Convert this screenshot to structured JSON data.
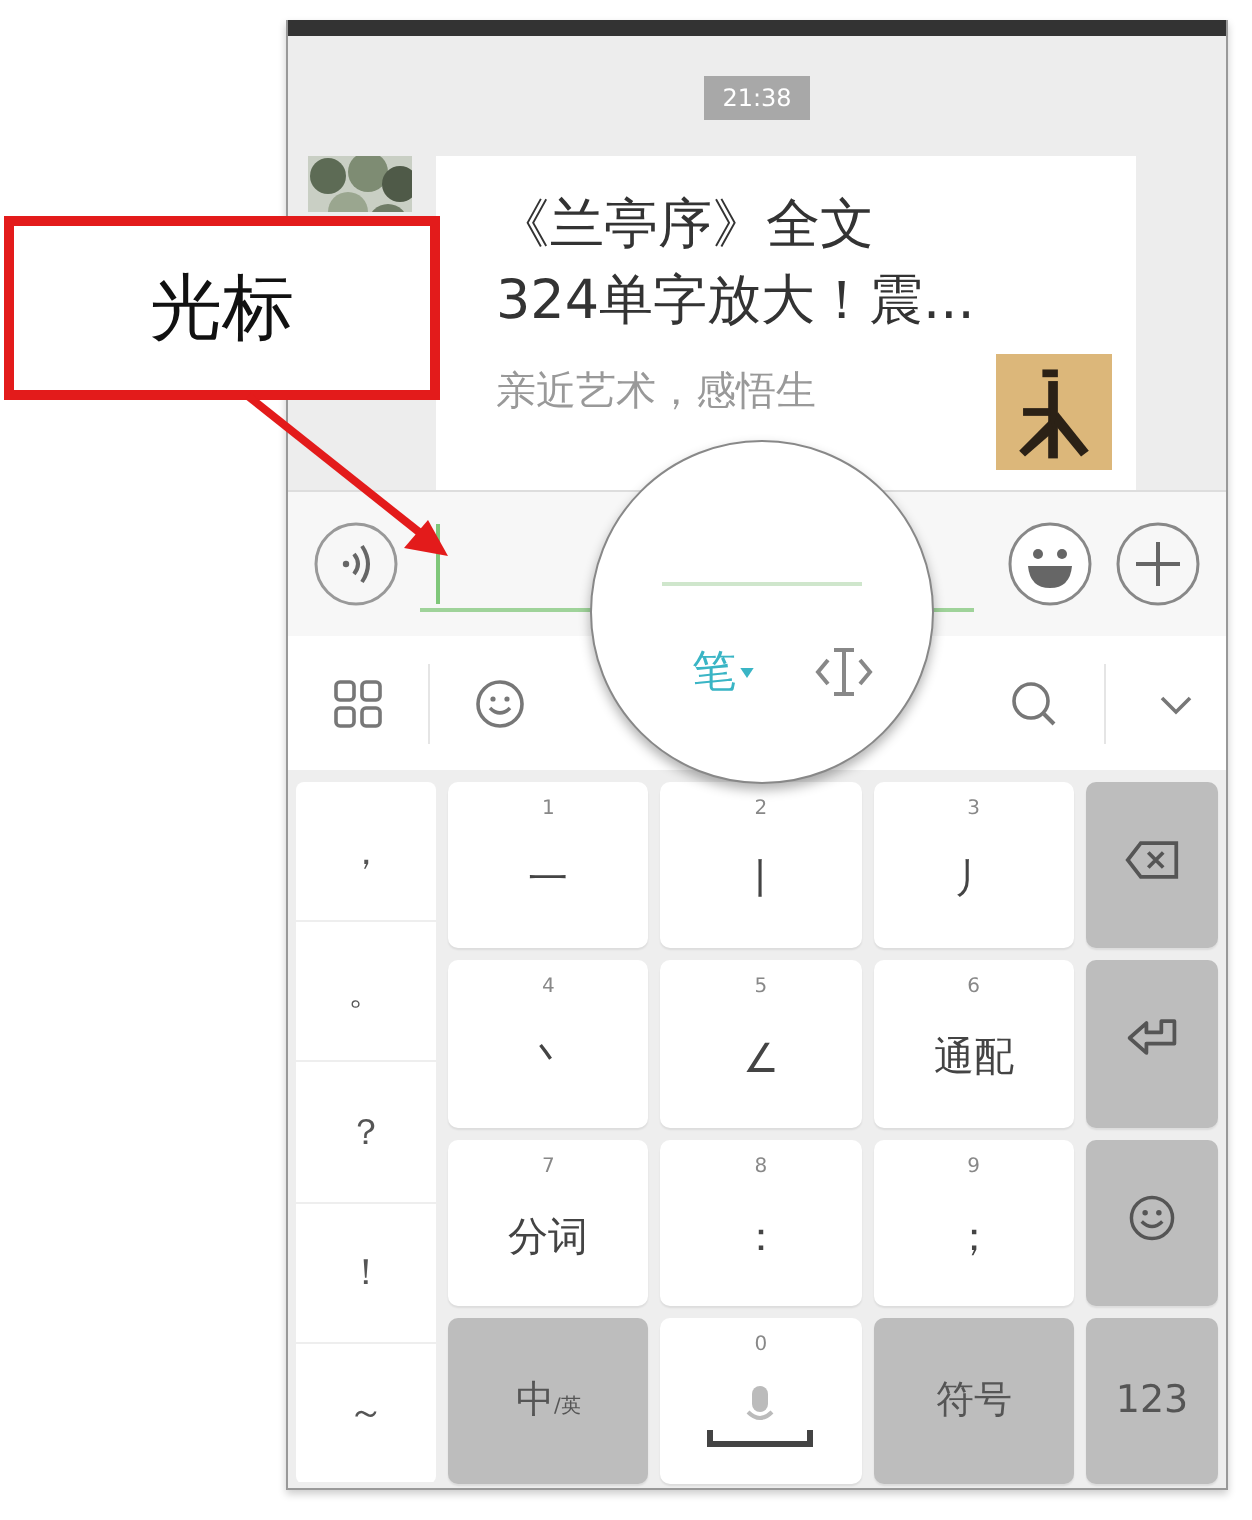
{
  "annotation": {
    "label": "光标"
  },
  "chat": {
    "time": "21:38",
    "article": {
      "title_lines": [
        "《兰亭序》全文",
        "324单字放大！震..."
      ],
      "summary": "亲近艺术，感悟生"
    }
  },
  "toolbar": {
    "mode_label": "笔"
  },
  "keyboard": {
    "symbols": [
      "，",
      "。",
      "？",
      "！",
      "～"
    ],
    "keys": [
      {
        "number": "1",
        "label": "一",
        "kind": "stroke"
      },
      {
        "number": "2",
        "label": "丨",
        "kind": "stroke"
      },
      {
        "number": "3",
        "label": "丿",
        "kind": "stroke"
      },
      {
        "kind": "backspace"
      },
      {
        "number": "4",
        "label": "丶",
        "kind": "stroke"
      },
      {
        "number": "5",
        "label": "∠",
        "kind": "stroke"
      },
      {
        "number": "6",
        "label": "通配",
        "kind": "stroke"
      },
      {
        "kind": "enter"
      },
      {
        "number": "7",
        "label": "分词",
        "kind": "stroke"
      },
      {
        "number": "8",
        "label": "：",
        "kind": "stroke"
      },
      {
        "number": "9",
        "label": "；",
        "kind": "stroke"
      },
      {
        "kind": "emoji"
      },
      {
        "label": "中$_{/英}$",
        "kind": "function"
      },
      {
        "number": "0",
        "kind": "space"
      },
      {
        "label": "符号",
        "kind": "function"
      },
      {
        "label": "123",
        "kind": "function"
      }
    ]
  }
}
